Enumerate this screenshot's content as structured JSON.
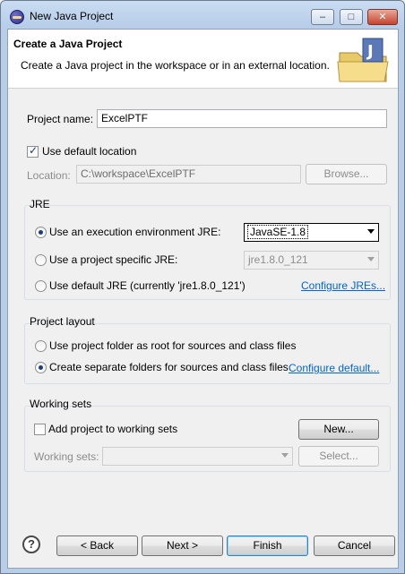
{
  "window": {
    "title": "New Java Project",
    "controls": {
      "minimize": "–",
      "maximize": "□",
      "close": "✕"
    }
  },
  "header": {
    "title": "Create a Java Project",
    "description": "Create a Java project in the workspace or in an external location."
  },
  "project_name": {
    "label": "Project name:",
    "value": "ExcelPTF"
  },
  "default_location": {
    "label": "Use default location",
    "checked": true
  },
  "location": {
    "label": "Location:",
    "value": "C:\\workspace\\ExcelPTF",
    "browse_label": "Browse..."
  },
  "jre": {
    "group_title": "JRE",
    "option_exec_env": {
      "label": "Use an execution environment JRE:",
      "selected": true,
      "value": "JavaSE-1.8"
    },
    "option_project_specific": {
      "label": "Use a project specific JRE:",
      "selected": false,
      "value": "jre1.8.0_121"
    },
    "option_default": {
      "label": "Use default JRE (currently 'jre1.8.0_121')",
      "selected": false
    },
    "configure_link": "Configure JREs..."
  },
  "project_layout": {
    "group_title": "Project layout",
    "option_root": {
      "label": "Use project folder as root for sources and class files",
      "selected": false
    },
    "option_separate": {
      "label": "Create separate folders for sources and class files",
      "selected": true
    },
    "configure_link": "Configure default..."
  },
  "working_sets": {
    "group_title": "Working sets",
    "add_label": "Add project to working sets",
    "add_checked": false,
    "new_label": "New...",
    "sets_label": "Working sets:",
    "sets_value": "",
    "select_label": "Select..."
  },
  "footer": {
    "help": "?",
    "back": "< Back",
    "next": "Next >",
    "finish": "Finish",
    "cancel": "Cancel"
  }
}
